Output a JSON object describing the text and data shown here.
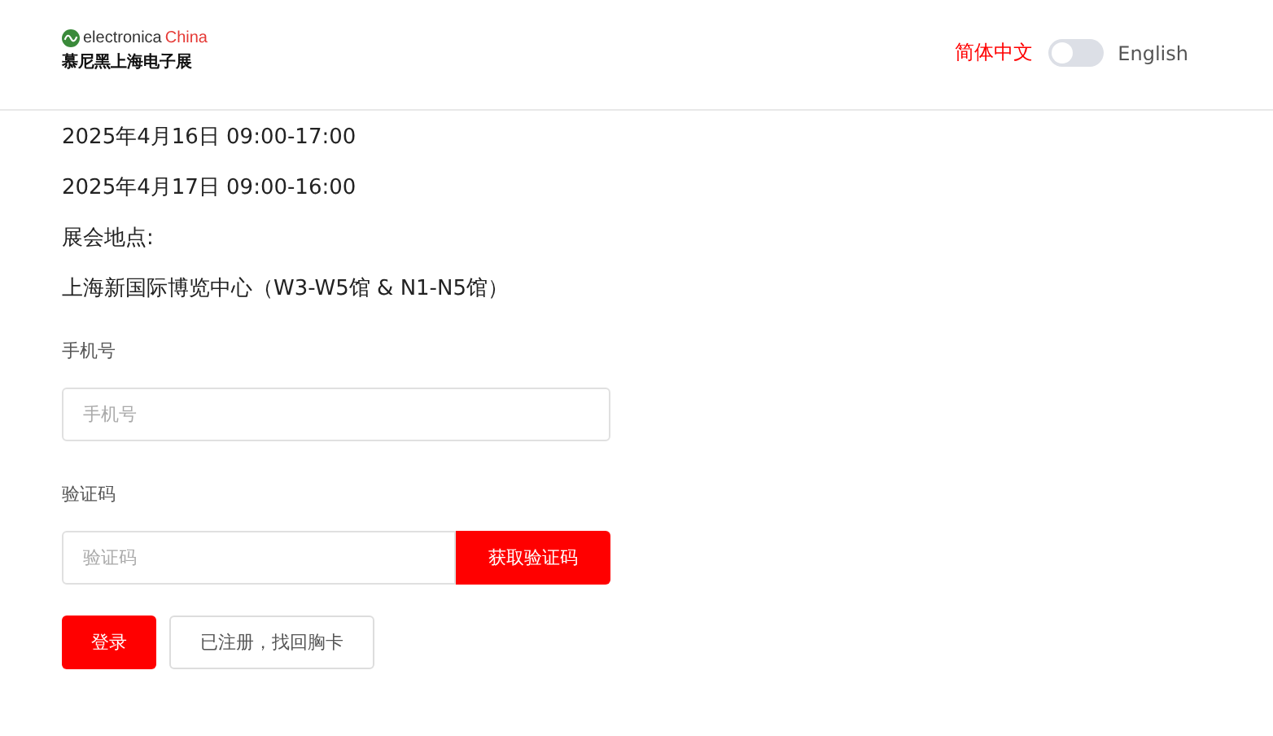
{
  "header": {
    "logo": {
      "brand": "electronica",
      "brand_accent": "China",
      "subtitle": "慕尼黑上海电子展"
    },
    "languages": [
      {
        "label": "简体中文",
        "selected": true
      },
      {
        "label": "English",
        "selected": false
      }
    ],
    "toggle": {
      "on": false
    }
  },
  "info_lines": [
    "2025年4月16日 09:00-17:00",
    "2025年4月17日 09:00-16:00",
    "展会地点:",
    "上海新国际博览中心（W3-W5馆 & N1-N5馆）"
  ],
  "phone": {
    "label": "手机号",
    "placeholder": "手机号"
  },
  "code": {
    "label": "验证码",
    "placeholder": "验证码",
    "button": "获取验证码"
  },
  "actions": [
    {
      "label": "登录",
      "kind": "primary"
    },
    {
      "label": "已注册，找回胸卡",
      "kind": "secondary"
    }
  ]
}
